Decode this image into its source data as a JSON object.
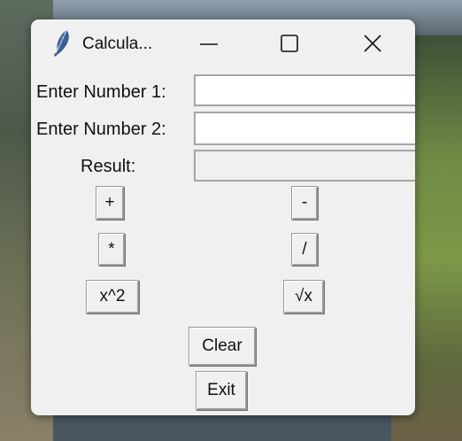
{
  "window": {
    "title": "Calcula...",
    "controls": {
      "minimize": "minimize",
      "maximize": "maximize",
      "close": "close"
    }
  },
  "form": {
    "number1_label": "Enter Number 1:",
    "number1_value": "",
    "number2_label": "Enter Number 2:",
    "number2_value": "",
    "result_label": "Result:",
    "result_value": ""
  },
  "buttons": {
    "add": "+",
    "subtract": "-",
    "multiply": "*",
    "divide": "/",
    "square": "x^2",
    "sqrt": "√x",
    "clear": "Clear",
    "exit": "Exit"
  },
  "icons": {
    "app": "feather-icon"
  }
}
